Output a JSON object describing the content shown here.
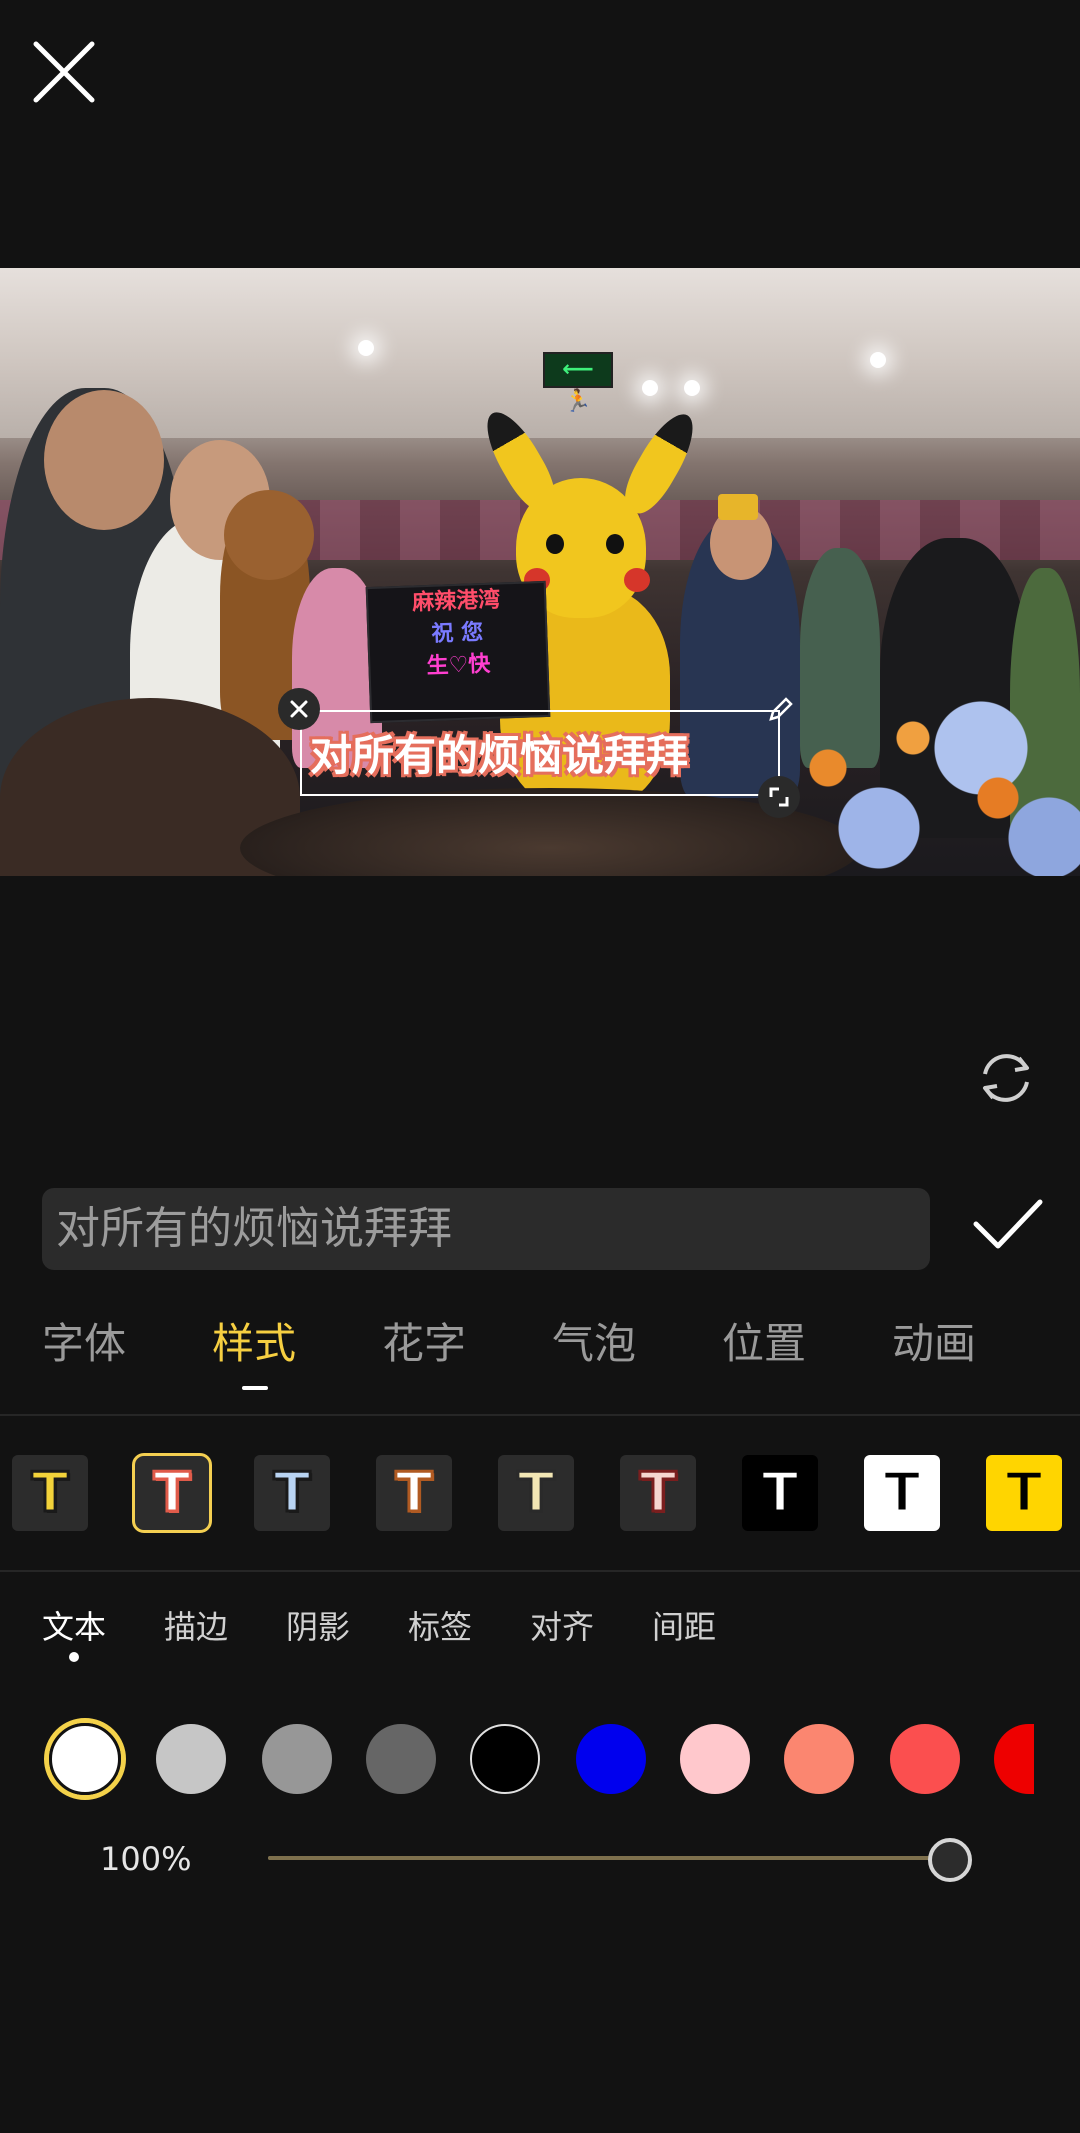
{
  "overlay": {
    "text": "对所有的烦恼说拜拜"
  },
  "sign_board": {
    "line1": "麻辣港湾",
    "line2": "祝 您",
    "line3": "生♡快"
  },
  "exit_sign": "⟵ 🏃",
  "text_input": {
    "value": "对所有的烦恼说拜拜"
  },
  "tabs": [
    {
      "label": "字体",
      "active": false
    },
    {
      "label": "样式",
      "active": true
    },
    {
      "label": "花字",
      "active": false
    },
    {
      "label": "气泡",
      "active": false
    },
    {
      "label": "位置",
      "active": false
    },
    {
      "label": "动画",
      "active": false
    }
  ],
  "style_presets": [
    {
      "glyph": "T",
      "fill": "#f2d23a",
      "stroke": "#1a1a1a",
      "bg": "#2c2c2c"
    },
    {
      "glyph": "T",
      "fill": "#ffffff",
      "stroke": "#e05b4a",
      "bg": "#2c2c2c",
      "selected": true
    },
    {
      "glyph": "T",
      "fill": "#b9d4f3",
      "stroke": "#1a1a1a",
      "bg": "#2c2c2c"
    },
    {
      "glyph": "T",
      "fill": "#ffffff",
      "stroke": "#b05a22",
      "bg": "#2c2c2c"
    },
    {
      "glyph": "T",
      "fill": "#f2e6b4",
      "stroke": "#2a2a2a",
      "bg": "#2c2c2c"
    },
    {
      "glyph": "T",
      "fill": "#f6d6d0",
      "stroke": "#7a1e1e",
      "bg": "#2c2c2c"
    },
    {
      "glyph": "T",
      "fill": "#ffffff",
      "stroke": "#000000",
      "bg": "#000000"
    },
    {
      "glyph": "T",
      "fill": "#000000",
      "stroke": "#ffffff",
      "bg": "#ffffff"
    },
    {
      "glyph": "T",
      "fill": "#000000",
      "stroke": "#ffd500",
      "bg": "#ffd500"
    }
  ],
  "subtabs": [
    {
      "label": "文本",
      "active": true
    },
    {
      "label": "描边",
      "active": false
    },
    {
      "label": "阴影",
      "active": false
    },
    {
      "label": "标签",
      "active": false
    },
    {
      "label": "对齐",
      "active": false
    },
    {
      "label": "间距",
      "active": false
    }
  ],
  "colors": [
    {
      "hex": "#ffffff",
      "selected": true
    },
    {
      "hex": "#c6c6c6"
    },
    {
      "hex": "#979797"
    },
    {
      "hex": "#666666"
    },
    {
      "hex": "#000000"
    },
    {
      "hex": "#0000ee"
    },
    {
      "hex": "#ffc8cc"
    },
    {
      "hex": "#fb8670"
    },
    {
      "hex": "#fb4f4f"
    },
    {
      "hex": "#ee0000"
    }
  ],
  "opacity": {
    "label": "100%",
    "value": 1.0
  },
  "icons": {
    "close": "close-icon",
    "refresh": "refresh-icon",
    "confirm": "checkmark-icon",
    "delete": "close-icon",
    "edit": "pencil-icon",
    "resize": "resize-icon"
  }
}
